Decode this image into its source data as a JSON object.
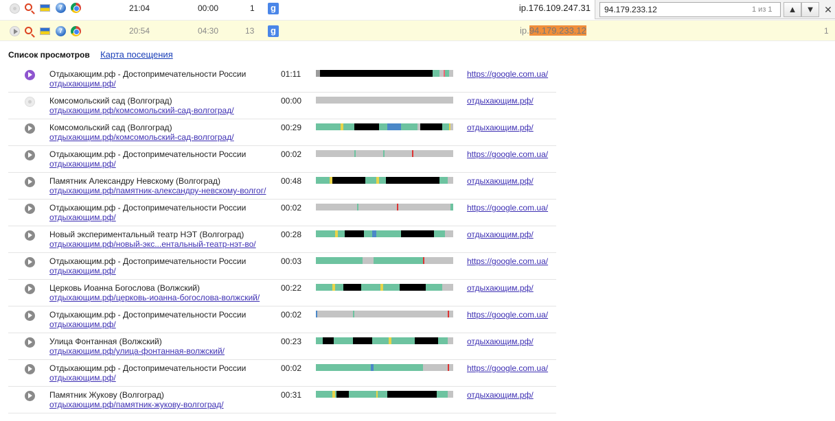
{
  "visits": [
    {
      "time": "21:04",
      "duration": "00:00",
      "views": "1",
      "source_icon": "google-g-icon",
      "ip_prefix": "ip.176.109.247.31",
      "ip_highlight": "",
      "count": "",
      "highlighted": false
    },
    {
      "time": "20:54",
      "duration": "04:30",
      "views": "13",
      "source_icon": "google-g-icon",
      "ip_prefix": "ip.",
      "ip_highlight": "94.179.233.12",
      "count": "1",
      "highlighted": true
    }
  ],
  "google_letter": "g",
  "os_glyph": "7",
  "findbar": {
    "query": "94.179.233.12",
    "count": "1 из 1",
    "prev": "▲",
    "next": "▼",
    "close": "✕"
  },
  "section": {
    "title": "Список просмотров",
    "map_link": "Карта посещения"
  },
  "pageviews": [
    {
      "title": "Отдыхающим.рф - Достопримечательности России",
      "url": "отдыхающим.рф/",
      "duration": "01:11",
      "referrer": "https://google.com.ua/",
      "state": "active",
      "bar": [
        [
          "#9c9c9c",
          3
        ],
        [
          "#000",
          82
        ],
        [
          "#6dc3a0",
          5
        ],
        [
          "#c4c4c4",
          3
        ],
        [
          "#e67",
          1
        ],
        [
          "#6dc3a0",
          3
        ],
        [
          "#c4c4c4",
          3
        ]
      ]
    },
    {
      "title": "Комсомольский сад (Волгоград)",
      "url": "отдыхающим.рф/комсомольский-сад-волгоград/",
      "duration": "00:00",
      "referrer": "отдыхающим.рф/",
      "state": "off",
      "bar": [
        [
          "#c4c4c4",
          100
        ]
      ]
    },
    {
      "title": "Комсомольский сад (Волгоград)",
      "url": "отдыхающим.рф/комсомольский-сад-волгоград/",
      "duration": "00:29",
      "referrer": "отдыхающим.рф/",
      "state": "normal",
      "bar": [
        [
          "#6dc3a0",
          18
        ],
        [
          "#e8d44a",
          2
        ],
        [
          "#6dc3a0",
          8
        ],
        [
          "#000",
          18
        ],
        [
          "#6dc3a0",
          6
        ],
        [
          "#4b88c8",
          10
        ],
        [
          "#6dc3a0",
          12
        ],
        [
          "#c4c4c4",
          2
        ],
        [
          "#000",
          16
        ],
        [
          "#6dc3a0",
          5
        ],
        [
          "#e8d44a",
          1
        ],
        [
          "#c4c4c4",
          2
        ]
      ]
    },
    {
      "title": "Отдыхающим.рф - Достопримечательности России",
      "url": "отдыхающим.рф/",
      "duration": "00:02",
      "referrer": "https://google.com.ua/",
      "state": "normal",
      "bar": [
        [
          "#c4c4c4",
          28
        ],
        [
          "#6dc3a0",
          1
        ],
        [
          "#c4c4c4",
          20
        ],
        [
          "#6dc3a0",
          1
        ],
        [
          "#c4c4c4",
          20
        ],
        [
          "#d33",
          1
        ],
        [
          "#c4c4c4",
          29
        ]
      ]
    },
    {
      "title": "Памятник Александру Невскому (Волгоград)",
      "url": "отдыхающим.рф/памятник-александру-невскому-волгог/",
      "duration": "00:48",
      "referrer": "отдыхающим.рф/",
      "state": "normal",
      "bar": [
        [
          "#6dc3a0",
          10
        ],
        [
          "#e8d44a",
          2
        ],
        [
          "#000",
          24
        ],
        [
          "#6dc3a0",
          8
        ],
        [
          "#e8d44a",
          2
        ],
        [
          "#6dc3a0",
          5
        ],
        [
          "#000",
          39
        ],
        [
          "#6dc3a0",
          6
        ],
        [
          "#c4c4c4",
          4
        ]
      ]
    },
    {
      "title": "Отдыхающим.рф - Достопримечательности России",
      "url": "отдыхающим.рф/",
      "duration": "00:02",
      "referrer": "https://google.com.ua/",
      "state": "normal",
      "bar": [
        [
          "#c4c4c4",
          30
        ],
        [
          "#6dc3a0",
          1
        ],
        [
          "#c4c4c4",
          28
        ],
        [
          "#d33",
          1
        ],
        [
          "#c4c4c4",
          38
        ],
        [
          "#6dc3a0",
          2
        ]
      ]
    },
    {
      "title": "Новый экспериментальный театр НЭТ (Волгоград)",
      "url": "отдыхающим.рф/новый-экс...ентальный-театр-нэт-во/",
      "duration": "00:28",
      "referrer": "отдыхающим.рф/",
      "state": "normal",
      "bar": [
        [
          "#6dc3a0",
          14
        ],
        [
          "#e8d44a",
          2
        ],
        [
          "#6dc3a0",
          5
        ],
        [
          "#000",
          14
        ],
        [
          "#6dc3a0",
          6
        ],
        [
          "#4b88c8",
          3
        ],
        [
          "#6dc3a0",
          18
        ],
        [
          "#000",
          24
        ],
        [
          "#6dc3a0",
          8
        ],
        [
          "#c4c4c4",
          6
        ]
      ]
    },
    {
      "title": "Отдыхающим.рф - Достопримечательности России",
      "url": "отдыхающим.рф/",
      "duration": "00:03",
      "referrer": "https://google.com.ua/",
      "state": "normal",
      "bar": [
        [
          "#6dc3a0",
          34
        ],
        [
          "#c4c4c4",
          8
        ],
        [
          "#6dc3a0",
          36
        ],
        [
          "#d33",
          1
        ],
        [
          "#c4c4c4",
          21
        ]
      ]
    },
    {
      "title": "Церковь Иоанна Богослова (Волжский)",
      "url": "отдыхающим.рф/церковь-иоанна-богослова-волжский/",
      "duration": "00:22",
      "referrer": "отдыхающим.рф/",
      "state": "normal",
      "bar": [
        [
          "#6dc3a0",
          12
        ],
        [
          "#e8d44a",
          2
        ],
        [
          "#6dc3a0",
          6
        ],
        [
          "#000",
          13
        ],
        [
          "#6dc3a0",
          14
        ],
        [
          "#e8d44a",
          2
        ],
        [
          "#6dc3a0",
          12
        ],
        [
          "#000",
          19
        ],
        [
          "#6dc3a0",
          12
        ],
        [
          "#c4c4c4",
          8
        ]
      ]
    },
    {
      "title": "Отдыхающим.рф - Достопримечательности России",
      "url": "отдыхающим.рф/",
      "duration": "00:02",
      "referrer": "https://google.com.ua/",
      "state": "normal",
      "bar": [
        [
          "#4b88c8",
          1
        ],
        [
          "#c4c4c4",
          26
        ],
        [
          "#6dc3a0",
          1
        ],
        [
          "#c4c4c4",
          68
        ],
        [
          "#d33",
          1
        ],
        [
          "#c4c4c4",
          3
        ]
      ]
    },
    {
      "title": "Улица Фонтанная (Волжский)",
      "url": "отдыхающим.рф/улица-фонтанная-волжский/",
      "duration": "00:23",
      "referrer": "отдыхающим.рф/",
      "state": "normal",
      "bar": [
        [
          "#6dc3a0",
          5
        ],
        [
          "#000",
          8
        ],
        [
          "#6dc3a0",
          14
        ],
        [
          "#000",
          14
        ],
        [
          "#6dc3a0",
          12
        ],
        [
          "#e8d44a",
          2
        ],
        [
          "#6dc3a0",
          17
        ],
        [
          "#000",
          17
        ],
        [
          "#6dc3a0",
          7
        ],
        [
          "#c4c4c4",
          4
        ]
      ]
    },
    {
      "title": "Отдыхающим.рф - Достопримечательности России",
      "url": "отдыхающим.рф/",
      "duration": "00:02",
      "referrer": "https://google.com.ua/",
      "state": "normal",
      "bar": [
        [
          "#6dc3a0",
          40
        ],
        [
          "#4b88c8",
          2
        ],
        [
          "#6dc3a0",
          36
        ],
        [
          "#c4c4c4",
          18
        ],
        [
          "#d33",
          1
        ],
        [
          "#c4c4c4",
          3
        ]
      ]
    },
    {
      "title": "Памятник Жукову (Волгоград)",
      "url": "отдыхающим.рф/памятник-жукову-волгоград/",
      "duration": "00:31",
      "referrer": "отдыхающим.рф/",
      "state": "normal",
      "bar": [
        [
          "#6dc3a0",
          12
        ],
        [
          "#e8d44a",
          2
        ],
        [
          "#6dc3a0",
          1
        ],
        [
          "#000",
          9
        ],
        [
          "#6dc3a0",
          20
        ],
        [
          "#e8d44a",
          1
        ],
        [
          "#6dc3a0",
          7
        ],
        [
          "#000",
          36
        ],
        [
          "#6dc3a0",
          8
        ],
        [
          "#c4c4c4",
          4
        ]
      ]
    }
  ]
}
